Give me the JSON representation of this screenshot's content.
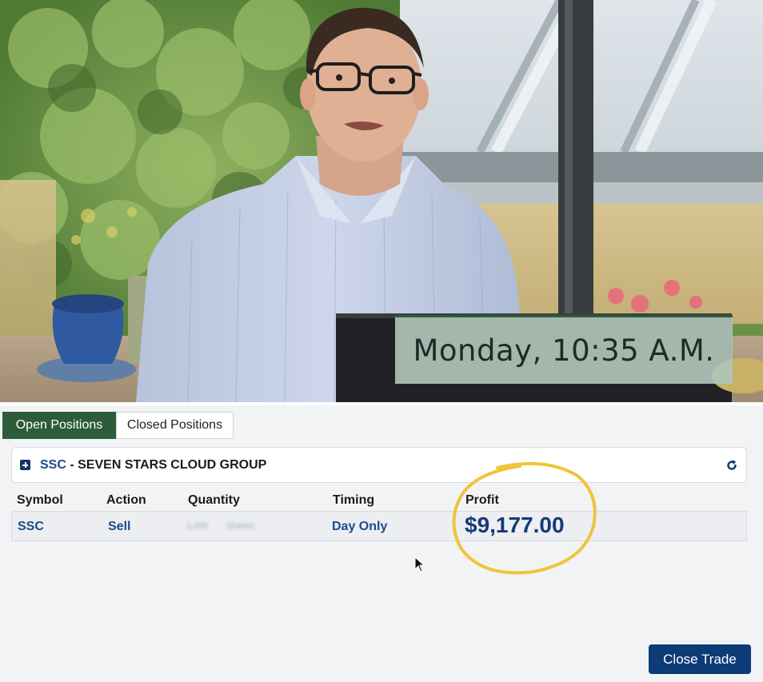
{
  "video": {
    "overlay_text": "Monday, 10:35 A.M."
  },
  "tabs": [
    {
      "label": "Open Positions",
      "active": true
    },
    {
      "label": "Closed Positions",
      "active": false
    }
  ],
  "position_group": {
    "symbol": "SSC",
    "name": "- SEVEN STARS CLOUD GROUP"
  },
  "table": {
    "columns": [
      "Symbol",
      "Action",
      "Quantity",
      "Timing",
      "Profit"
    ],
    "rows": [
      {
        "symbol": "SSC",
        "action": "Sell",
        "quantity_number": "1,000",
        "quantity_unit": "Shares",
        "timing": "Day Only",
        "profit": "$9,177.00"
      }
    ]
  },
  "buttons": {
    "close_trade": "Close Trade"
  },
  "colors": {
    "active_tab": "#2d5c3a",
    "link_blue": "#1d4a8f",
    "profit_blue": "#163a78",
    "button_blue": "#0d3b78",
    "highlight_circle": "#f0c43a"
  },
  "icons": {
    "expand": "plus-square-icon",
    "refresh": "refresh-icon",
    "cursor": "mouse-pointer-icon"
  }
}
